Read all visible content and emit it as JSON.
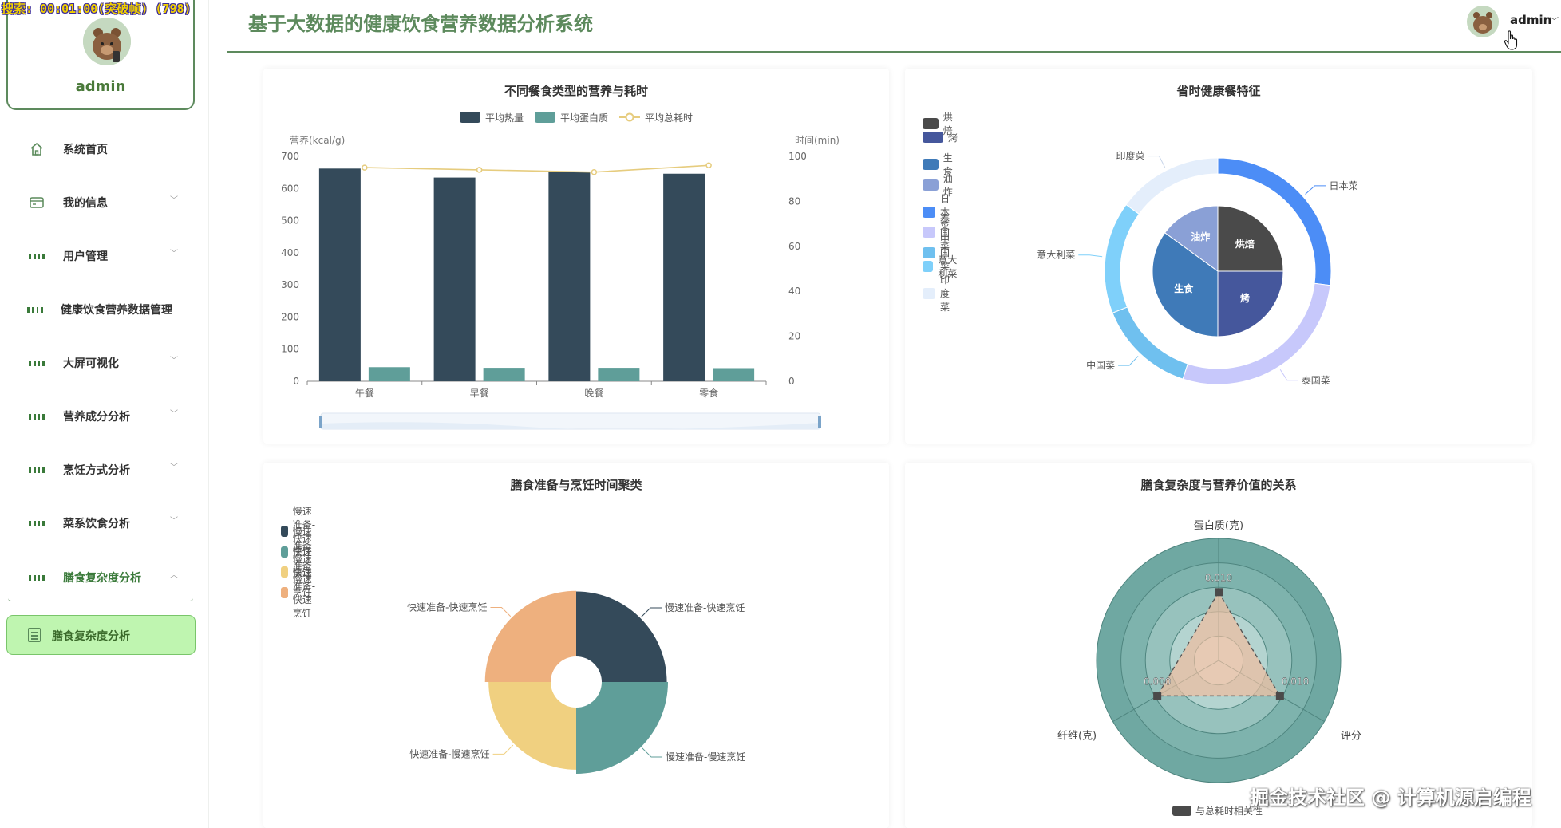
{
  "recording_overlay": "搜索: 00:01:00(突破帧) (798)",
  "watermark": "掘金技术社区 @ 计算机源启编程",
  "header": {
    "title": "基于大数据的健康饮食营养数据分析系统",
    "user": "admin"
  },
  "sidebar": {
    "profile_name": "admin",
    "items": [
      {
        "label": "系统首页",
        "icon": "home-icon",
        "has_chevron": false
      },
      {
        "label": "我的信息",
        "icon": "id-card-icon",
        "has_chevron": true
      },
      {
        "label": "用户管理",
        "icon": "grid-icon",
        "has_chevron": true
      },
      {
        "label": "健康饮食营养数据管理",
        "icon": "grid-icon",
        "has_chevron": false
      },
      {
        "label": "大屏可视化",
        "icon": "grid-icon",
        "has_chevron": true
      },
      {
        "label": "营养成分分析",
        "icon": "grid-icon",
        "has_chevron": true
      },
      {
        "label": "烹饪方式分析",
        "icon": "grid-icon",
        "has_chevron": true
      },
      {
        "label": "菜系饮食分析",
        "icon": "grid-icon",
        "has_chevron": true
      },
      {
        "label": "膳食复杂度分析",
        "icon": "grid-icon",
        "has_chevron": true,
        "expanded": true
      }
    ],
    "active_subitem": "膳食复杂度分析"
  },
  "charts": {
    "bar": {
      "title": "不同餐食类型的营养与耗时",
      "legend": [
        "平均热量",
        "平均蛋白质",
        "平均总耗时"
      ],
      "y_left_label": "营养(kcal/g)",
      "y_right_label": "时间(min)",
      "y_left_ticks": [
        "700",
        "600",
        "500",
        "400",
        "300",
        "200",
        "100",
        "0"
      ],
      "y_right_ticks": [
        "100",
        "80",
        "60",
        "40",
        "20",
        "0"
      ]
    },
    "sunburst": {
      "title": "省时健康餐特征"
    },
    "rose": {
      "title": "膳食准备与烹饪时间聚类"
    },
    "radar": {
      "title": "膳食复杂度与营养价值的关系",
      "legend": [
        "与总耗时相关性"
      ]
    }
  },
  "chart_data": [
    {
      "type": "bar",
      "title": "不同餐食类型的营养与耗时",
      "categories": [
        "午餐",
        "早餐",
        "晚餐",
        "零食"
      ],
      "series": [
        {
          "name": "平均热量",
          "type": "bar",
          "axis": "left",
          "values": [
            662,
            634,
            652,
            646
          ],
          "color": "#344a5a"
        },
        {
          "name": "平均蛋白质",
          "type": "bar",
          "axis": "left",
          "values": [
            44,
            42,
            42,
            41
          ],
          "color": "#5f9e99"
        },
        {
          "name": "平均总耗时",
          "type": "line",
          "axis": "right",
          "values": [
            95,
            94,
            93,
            96
          ],
          "color": "#e6cc7e"
        }
      ],
      "ylabel": "营养(kcal/g)",
      "y2label": "时间(min)",
      "ylim": [
        0,
        700
      ],
      "y2lim": [
        0,
        100
      ],
      "grid": false,
      "legend_position": "top"
    },
    {
      "type": "pie",
      "subtype": "sunburst",
      "title": "省时健康餐特征",
      "legend": [
        "烘焙",
        "烤",
        "生食",
        "油炸",
        "日本菜",
        "泰国菜",
        "中国菜",
        "意大利菜",
        "印度菜"
      ],
      "inner": [
        {
          "name": "烘焙",
          "value": 25,
          "color": "#4a4a4a"
        },
        {
          "name": "烤",
          "value": 25,
          "color": "#45579c"
        },
        {
          "name": "生食",
          "value": 35,
          "color": "#3f7ab8"
        },
        {
          "name": "油炸",
          "value": 15,
          "color": "#8aa0d6"
        }
      ],
      "outer": [
        {
          "name": "日本菜",
          "value": 27,
          "color": "#4c8df6"
        },
        {
          "name": "泰国菜",
          "value": 28,
          "color": "#c7c8fb"
        },
        {
          "name": "中国菜",
          "value": 14,
          "color": "#6fc0ef"
        },
        {
          "name": "意大利菜",
          "value": 16,
          "color": "#7fd0fa"
        },
        {
          "name": "印度菜",
          "value": 15,
          "color": "#e4eefb"
        }
      ],
      "legend_position": "top-left"
    },
    {
      "type": "pie",
      "subtype": "rose",
      "title": "膳食准备与烹饪时间聚类",
      "legend": [
        "慢速准备-快速烹饪",
        "慢速准备-慢速烹饪",
        "快速准备-慢速烹饪",
        "快速准备-快速烹饪"
      ],
      "slices": [
        {
          "name": "慢速准备-快速烹饪",
          "value": 112,
          "color": "#344a5a"
        },
        {
          "name": "慢速准备-慢速烹饪",
          "value": 116,
          "color": "#5f9e99"
        },
        {
          "name": "快速准备-慢速烹饪",
          "value": 102,
          "color": "#f0d080"
        },
        {
          "name": "快速准备-快速烹饪",
          "value": 114,
          "color": "#eeb07e"
        }
      ],
      "legend_position": "top-left"
    },
    {
      "type": "radar",
      "title": "膳食复杂度与营养价值的关系",
      "indicators": [
        "蛋白质(克)",
        "评分",
        "纤维(克)"
      ],
      "series": [
        {
          "name": "与总耗时相关性",
          "values": [
            0.01,
            0.01,
            0.0
          ],
          "color": "#4a4a4a"
        }
      ],
      "value_labels": [
        "0.010",
        "0.010",
        "0.000"
      ],
      "legend_position": "bottom"
    }
  ]
}
